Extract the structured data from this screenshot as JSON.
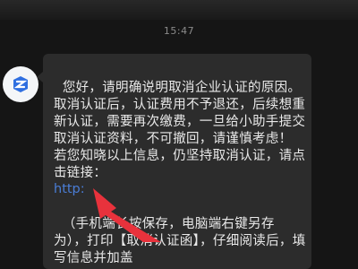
{
  "status_bar": {
    "time": "15:47"
  },
  "sender": {
    "avatar_icon": "assistant-logo-icon"
  },
  "message": {
    "body": "您好，请明确说明取消企业认证的原因。取消认证后，认证费用不予退还，后续想重新认证，需要再次缴费，一旦给小助手提交取消认证资料，不可撤回，请谨慎考虑！\n若您知晓以上信息，仍坚持取消认证，请点击链接：",
    "link_text": "http:",
    "after_link": "（手机端长按保存，电脑端右键另存为），打印【取消认证函】，仔细阅读后，填写信息并加盖"
  },
  "colors": {
    "background": "#151515",
    "bubble": "#2c2c2c",
    "link": "#4a7dd6",
    "arrow": "#e8323c"
  }
}
